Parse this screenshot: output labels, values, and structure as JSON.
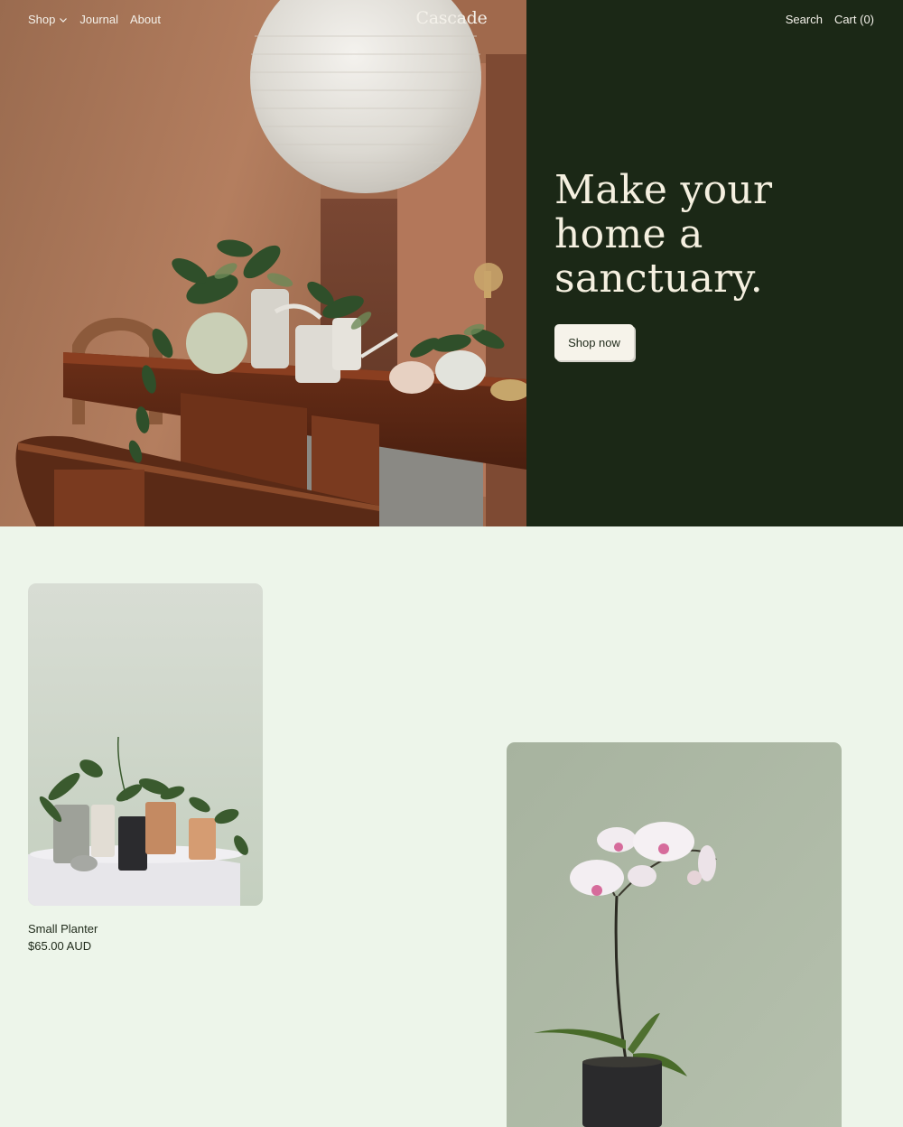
{
  "nav": {
    "shop_label": "Shop",
    "journal_label": "Journal",
    "about_label": "About",
    "logo": "Cascade",
    "search_label": "Search",
    "cart_label": "Cart (0)"
  },
  "hero": {
    "title_line1": "Make your",
    "title_line2": "home a",
    "title_line3": "sanctuary.",
    "cta_label": "Shop now",
    "panel_color": "#1b2816"
  },
  "products": [
    {
      "name": "Small Planter",
      "price": "$65.00 AUD"
    }
  ],
  "colors": {
    "page_bg": "#edf5ea",
    "text_dark": "#1f2a1a",
    "text_light": "#f4f1ea"
  }
}
